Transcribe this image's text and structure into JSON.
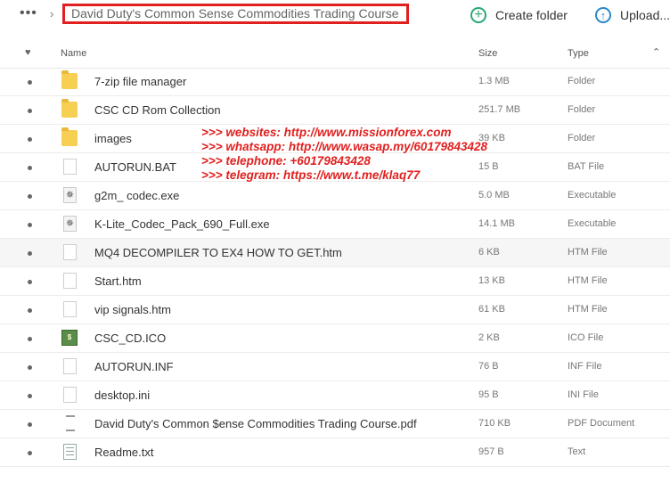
{
  "breadcrumb": {
    "more_label": "•••",
    "current_folder": "David Duty's Common Sense Commodities Trading Course"
  },
  "actions": {
    "create_folder": "Create folder",
    "upload": "Upload..."
  },
  "columns": {
    "name": "Name",
    "size": "Size",
    "type": "Type"
  },
  "icons": {
    "more": "more-dots-icon",
    "chevron": "chevron-right-icon",
    "favorite": "heart-icon",
    "sort": "sort-ascending-icon",
    "create": "plus-circle-icon",
    "upload": "upload-arrow-icon"
  },
  "files": [
    {
      "name": "7-zip file manager",
      "size": "1.3 MB",
      "type": "Folder",
      "icon": "folder"
    },
    {
      "name": "CSC CD Rom Collection",
      "size": "251.7 MB",
      "type": "Folder",
      "icon": "folder"
    },
    {
      "name": "images",
      "size": "39 KB",
      "type": "Folder",
      "icon": "folder"
    },
    {
      "name": "AUTORUN.BAT",
      "size": "15 B",
      "type": "BAT File",
      "icon": "file"
    },
    {
      "name": "g2m_ codec.exe",
      "size": "5.0 MB",
      "type": "Executable",
      "icon": "exe"
    },
    {
      "name": "K-Lite_Codec_Pack_690_Full.exe",
      "size": "14.1 MB",
      "type": "Executable",
      "icon": "exe"
    },
    {
      "name": "MQ4 DECOMPILER TO EX4 HOW TO GET.htm",
      "size": "6 KB",
      "type": "HTM File",
      "icon": "file"
    },
    {
      "name": "Start.htm",
      "size": "13 KB",
      "type": "HTM File",
      "icon": "file"
    },
    {
      "name": "vip signals.htm",
      "size": "61 KB",
      "type": "HTM File",
      "icon": "file"
    },
    {
      "name": "CSC_CD.ICO",
      "size": "2 KB",
      "type": "ICO File",
      "icon": "ico"
    },
    {
      "name": "AUTORUN.INF",
      "size": "76 B",
      "type": "INF File",
      "icon": "file"
    },
    {
      "name": "desktop.ini",
      "size": "95 B",
      "type": "INI File",
      "icon": "file"
    },
    {
      "name": "David Duty's Common $ense Commodities Trading Course.pdf",
      "size": "710 KB",
      "type": "PDF Document",
      "icon": "pdf"
    },
    {
      "name": "Readme.txt",
      "size": "957 B",
      "type": "Text",
      "icon": "txt"
    }
  ],
  "overlay": [
    ">>> websites: http://www.missionforex.com",
    ">>> whatsapp: http://www.wasap.my/60179843428",
    ">>> telephone: +60179843428",
    ">>> telegram: https://www.t.me/klaq77"
  ],
  "colors": {
    "overlay_text": "#e0201f",
    "breadcrumb_border": "#e0201f",
    "create_accent": "#2aa876",
    "upload_accent": "#2a87c8",
    "folder": "#f7cf53"
  }
}
